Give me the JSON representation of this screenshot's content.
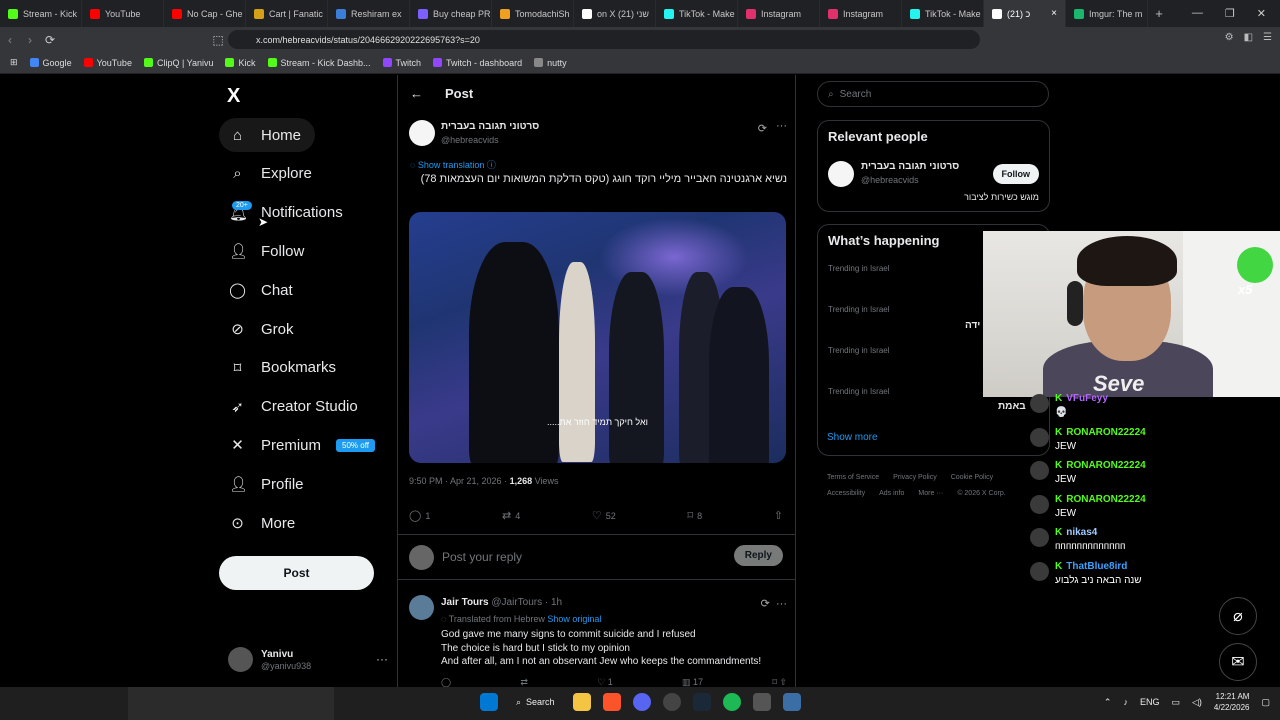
{
  "browser": {
    "tabs": [
      {
        "label": "Stream - Kick",
        "color": "#53fc18"
      },
      {
        "label": "YouTube",
        "color": "#ff0000"
      },
      {
        "label": "No Cap - Ghe",
        "color": "#ff0000"
      },
      {
        "label": "Cart | Fanatic",
        "color": "#d4a017"
      },
      {
        "label": "Reshiram ex",
        "color": "#3b7dd8"
      },
      {
        "label": "Buy cheap PR",
        "color": "#7d5fff"
      },
      {
        "label": "TomodachiSh",
        "color": "#f0a020"
      },
      {
        "label": "on X שני (21)",
        "color": "#ffffff"
      },
      {
        "label": "TikTok - Make",
        "color": "#25f4ee"
      },
      {
        "label": "Instagram",
        "color": "#e1306c"
      },
      {
        "label": "Instagram",
        "color": "#e1306c"
      },
      {
        "label": "TikTok - Make",
        "color": "#25f4ee"
      },
      {
        "label": "Imgur: The m",
        "color": "#1bb76e"
      }
    ],
    "active_tab": {
      "label": "כ (21)"
    },
    "url": "x.com/hebreacvids/status/2046662920222695763?s=20",
    "bookmarks": [
      {
        "label": "Google",
        "color": "#4285f4"
      },
      {
        "label": "YouTube",
        "color": "#ff0000"
      },
      {
        "label": "ClipQ | Yanivu",
        "color": "#53fc18"
      },
      {
        "label": "Kick",
        "color": "#53fc18"
      },
      {
        "label": "Stream - Kick Dashb...",
        "color": "#53fc18"
      },
      {
        "label": "Twitch",
        "color": "#9146ff"
      },
      {
        "label": "Twitch - dashboard",
        "color": "#9146ff"
      },
      {
        "label": "nutty",
        "color": "#888888"
      }
    ]
  },
  "nav": {
    "logo": "X",
    "items": [
      {
        "label": "Home",
        "icon": "home-icon"
      },
      {
        "label": "Explore",
        "icon": "search-icon"
      },
      {
        "label": "Notifications",
        "icon": "bell-icon",
        "badge": "20+"
      },
      {
        "label": "Follow",
        "icon": "person-plus-icon"
      },
      {
        "label": "Chat",
        "icon": "chat-icon"
      },
      {
        "label": "Grok",
        "icon": "grok-icon"
      },
      {
        "label": "Bookmarks",
        "icon": "bookmark-icon"
      },
      {
        "label": "Creator Studio",
        "icon": "rocket-icon"
      },
      {
        "label": "Premium",
        "icon": "x-icon",
        "promo": "50% off"
      },
      {
        "label": "Profile",
        "icon": "person-icon"
      },
      {
        "label": "More",
        "icon": "more-circle-icon"
      }
    ],
    "post_button": "Post",
    "account": {
      "name": "Yanivu",
      "handle": "@yanivu938"
    }
  },
  "main": {
    "header": "Post",
    "tweet": {
      "name": "סרטוני תגובה בעברית",
      "handle": "@hebreacvids",
      "show_translation": "Show translation",
      "text": "נשיא ארגנטינה חאבייר מיליי רוקד חוגג (טקס הדלקת המשואות יום העצמאות 78)",
      "video_caption": "ואל חיקך תמיד חוזר את.....",
      "time": "9:50 PM · Apr 21, 2026 · ",
      "views_num": "1,268",
      "views_label": " Views",
      "replies": "1",
      "reposts": "4",
      "likes": "52",
      "bookmarks": "8"
    },
    "reply_box": {
      "placeholder": "Post your reply",
      "button": "Reply"
    },
    "reply": {
      "name": "Jair Tours",
      "meta": " @JairTours · 1h",
      "translated_label": "Translated from Hebrew ",
      "show_original": "Show original",
      "lines": [
        "God gave me many signs to commit suicide and I refused",
        "The choice is hard but I stick to my opinion",
        "And after all, am I not an observant Jew who keeps the commandments!"
      ],
      "replies": "",
      "reposts": "",
      "likes": "1",
      "views": "17"
    }
  },
  "sidebar": {
    "search_placeholder": "Search",
    "relevant_people": {
      "title": "Relevant people",
      "name": "סרטוני תגובה בעברית",
      "handle": "@hebreacvids",
      "follow": "Follow",
      "bio": "מוגש כשירות לציבור"
    },
    "happening": {
      "title": "What’s happening",
      "trends": [
        {
          "context": "Trending in Israel",
          "text": ""
        },
        {
          "context": "Trending in Israel",
          "text": "ידה"
        },
        {
          "context": "Trending in Israel",
          "text": ""
        },
        {
          "context": "Trending in Israel",
          "text": "באמת"
        }
      ],
      "show_more": "Show more"
    },
    "footer": {
      "links": [
        "Terms of Service",
        "Privacy Policy",
        "Cookie Policy",
        "Accessibility",
        "Ads info",
        "More ···"
      ],
      "copyright": "© 2026 X Corp."
    }
  },
  "overlay": {
    "chat": [
      {
        "user": "VFuFeyy",
        "text": "💀",
        "color": "#b565ff"
      },
      {
        "user": "RONARON22224",
        "text": "JEW",
        "color": "#53fc18"
      },
      {
        "user": "RONARON22224",
        "text": "JEW",
        "color": "#53fc18"
      },
      {
        "user": "RONARON22224",
        "text": "JEW",
        "color": "#53fc18"
      },
      {
        "user": "nikas4",
        "text": "ппппппппппппп",
        "color": "#9ecbff"
      },
      {
        "user": "ThatBlue8ird",
        "text": "שנה הבאה ניב גלבוע",
        "color": "#3ea0ff"
      }
    ],
    "multiplier": "x5",
    "cam_text": "Seve"
  },
  "taskbar": {
    "search": "Search",
    "lang": "ENG",
    "time": "12:21 AM",
    "date": "4/22/2026"
  }
}
